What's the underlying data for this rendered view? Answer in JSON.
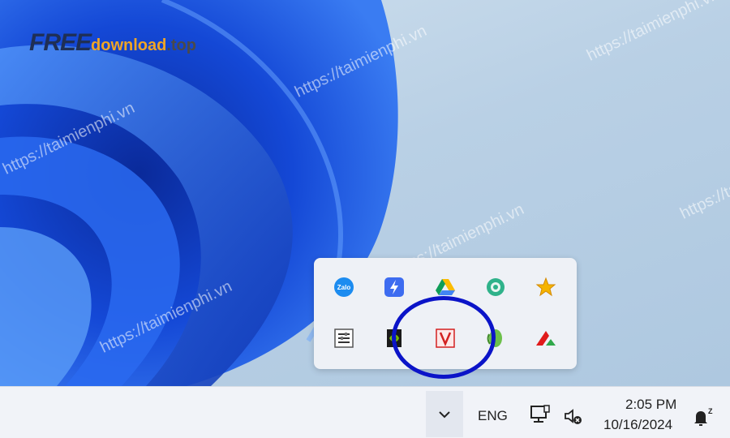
{
  "watermark": {
    "logo_free": "FREE",
    "logo_download": "download",
    "logo_top": ".top",
    "site_text": "https://taimienphi.vn"
  },
  "tray_flyout": {
    "icons": [
      {
        "name": "zalo-icon",
        "label": "Zalo",
        "color": "#1c8cf0"
      },
      {
        "name": "lightning-icon",
        "color": "#3d6cf0"
      },
      {
        "name": "google-drive-icon"
      },
      {
        "name": "green-circle-icon",
        "color": "#2fb28a"
      },
      {
        "name": "star-icon",
        "color": "#f5b400"
      },
      {
        "name": "settings-panel-icon"
      },
      {
        "name": "nvidia-icon",
        "color": "#76b900"
      },
      {
        "name": "v-app-icon",
        "color": "#d32020"
      },
      {
        "name": "android-icon",
        "color": "#6cc04a"
      },
      {
        "name": "red-green-arrow-icon",
        "color": "#e01b1b"
      }
    ]
  },
  "taskbar": {
    "language": "ENG",
    "time": "2:05 PM",
    "date": "10/16/2024",
    "notification_badge": "Z"
  },
  "colors": {
    "highlight": "#0b14c8",
    "bloom": "#1a4fd8"
  }
}
